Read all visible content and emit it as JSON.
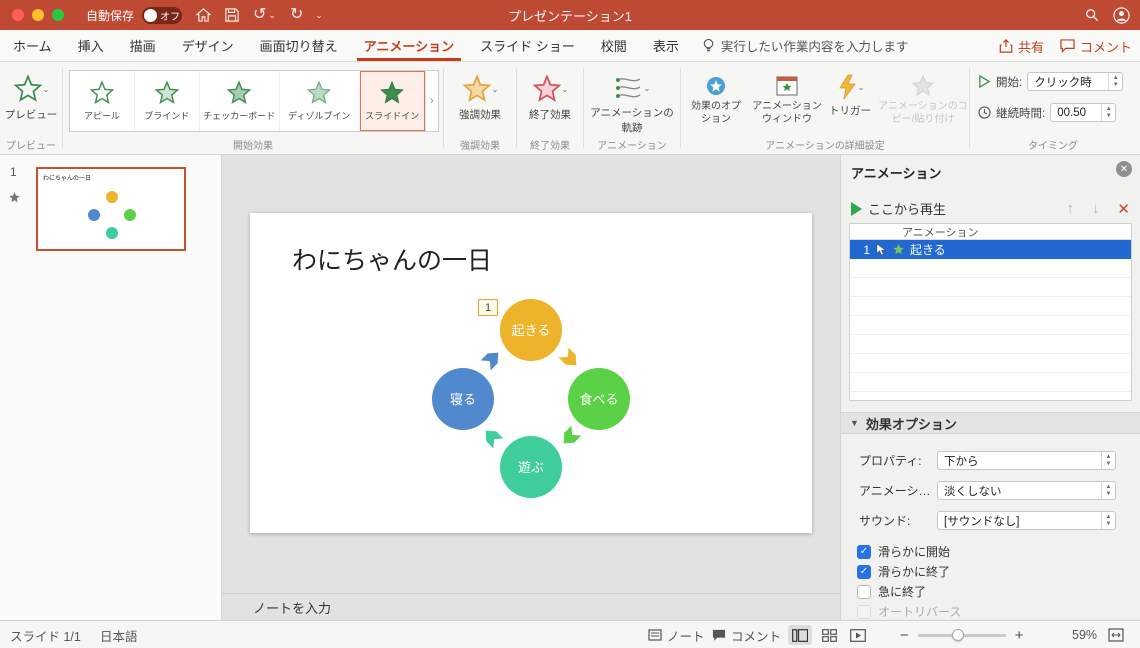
{
  "colors": {
    "titlebar": "#BE4A33",
    "accent_red": "#C43E1C",
    "selection_blue": "#2268D1",
    "star_green": "#3E8E4E",
    "star_orange": "#E8A33D",
    "star_red": "#D5515C"
  },
  "titlebar": {
    "autosave_label": "自動保存",
    "autosave_state": "オフ",
    "title": "プレゼンテーション1"
  },
  "tabs": {
    "items": [
      {
        "label": "ホーム"
      },
      {
        "label": "挿入"
      },
      {
        "label": "描画"
      },
      {
        "label": "デザイン"
      },
      {
        "label": "画面切り替え"
      },
      {
        "label": "アニメーション"
      },
      {
        "label": "スライド ショー"
      },
      {
        "label": "校閲"
      },
      {
        "label": "表示"
      }
    ],
    "tell_me": "実行したい作業内容を入力します",
    "share": "共有",
    "comments": "コメント"
  },
  "ribbon": {
    "preview": "プレビュー",
    "gallery": [
      {
        "label": "アピール"
      },
      {
        "label": "ブラインド"
      },
      {
        "label": "チェッカーボード"
      },
      {
        "label": "ディゾルブイン"
      },
      {
        "label": "スライドイン"
      }
    ],
    "emphasis": "強調効果",
    "exit": "終了効果",
    "motion_paths": "アニメーションの軌跡",
    "effect_options": "効果のオプション",
    "animation_window": "アニメーション ウィンドウ",
    "trigger": "トリガー",
    "painter": "アニメーションのコピー/貼り付け",
    "start_label": "開始:",
    "start_value": "クリック時",
    "duration_label": "継続時間:",
    "duration_value": "00.50",
    "groups": [
      "プレビュー",
      "開始効果",
      "強調効果",
      "終了効果",
      "アニメーション",
      "アニメーションの詳細設定",
      "タイミング"
    ]
  },
  "thumbnails": {
    "slide_number": "1",
    "title": "わにちゃんの一日"
  },
  "slide": {
    "title": "わにちゃんの一日",
    "animation_badge": "1",
    "shapes": [
      {
        "label": "起きる",
        "color": "#EDB32A"
      },
      {
        "label": "食べる",
        "color": "#5BD145"
      },
      {
        "label": "遊ぶ",
        "color": "#3FCE99"
      },
      {
        "label": "寝る",
        "color": "#5189CF"
      }
    ],
    "notes_placeholder": "ノートを入力"
  },
  "animation_pane": {
    "title": "アニメーション",
    "play_from": "ここから再生",
    "list_header": "アニメーション",
    "items": [
      {
        "order": "1",
        "label": "起きる"
      }
    ],
    "effect_options_title": "効果オプション",
    "fields": [
      {
        "label": "プロパティ:",
        "value": "下から"
      },
      {
        "label": "アニメーシ…",
        "value": "淡くしない"
      },
      {
        "label": "サウンド:",
        "value": "[サウンドなし]"
      }
    ],
    "checkboxes": [
      {
        "label": "滑らかに開始",
        "checked": true
      },
      {
        "label": "滑らかに終了",
        "checked": true
      },
      {
        "label": "急に終了",
        "checked": false
      },
      {
        "label": "オートリバース",
        "checked": false,
        "disabled": true
      }
    ]
  },
  "statusbar": {
    "slide_info": "スライド 1/1",
    "language": "日本語",
    "notes": "ノート",
    "comments": "コメント",
    "zoom": "59%"
  }
}
